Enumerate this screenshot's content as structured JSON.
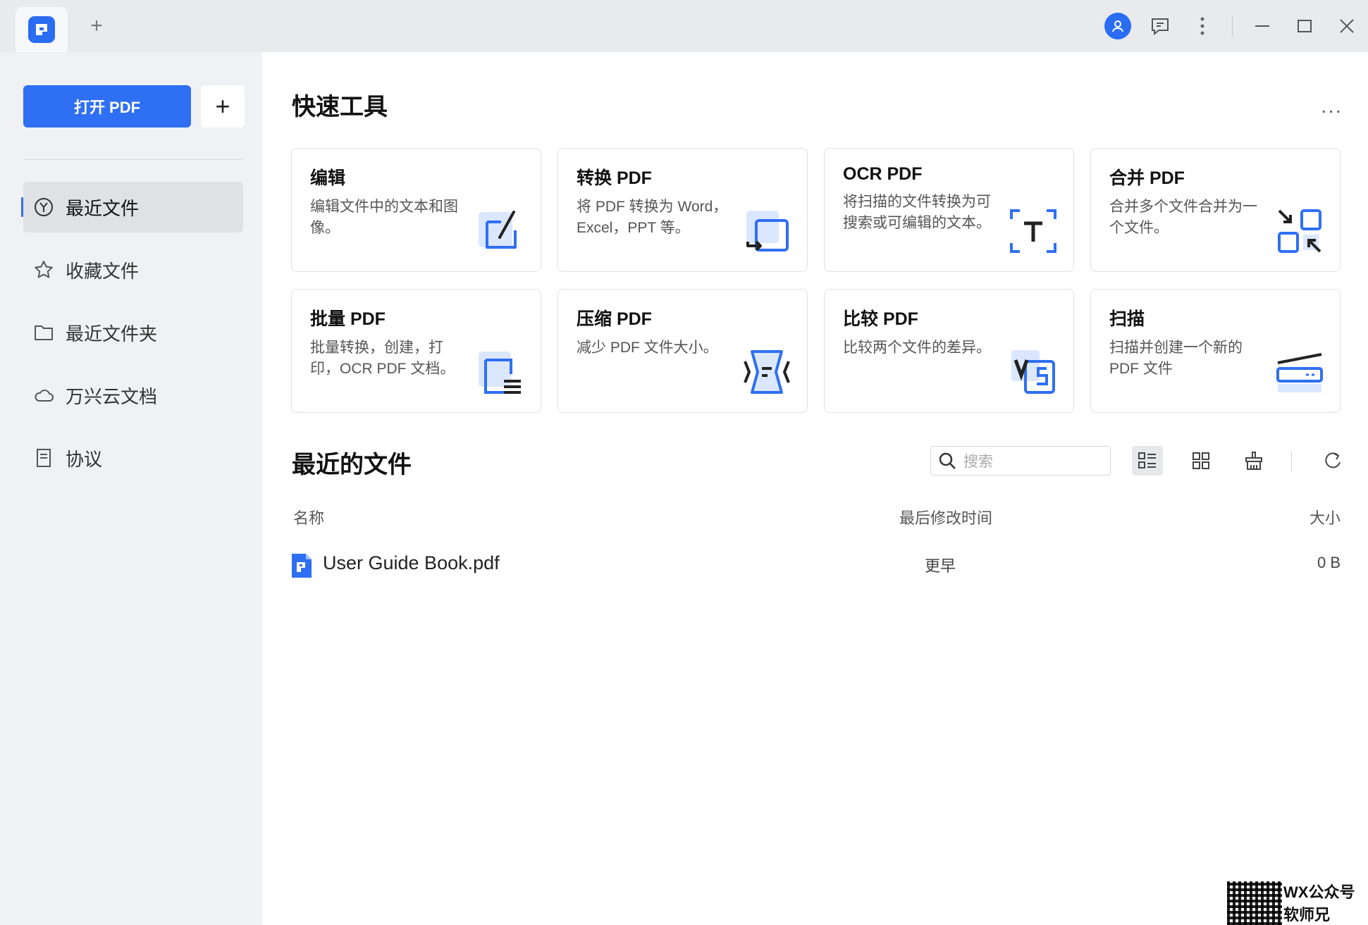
{
  "titlebar": {
    "new_tab_label": "+",
    "icons": [
      "app-logo-icon",
      "user-avatar-icon",
      "feedback-icon",
      "more-vertical-icon",
      "minimize-icon",
      "maximize-icon",
      "close-icon"
    ]
  },
  "sidebar": {
    "open_pdf_label": "打开 PDF",
    "add_label": "+",
    "items": [
      {
        "label": "最近文件",
        "icon": "recent-icon",
        "active": true
      },
      {
        "label": "收藏文件",
        "icon": "star-icon",
        "active": false
      },
      {
        "label": "最近文件夹",
        "icon": "folder-icon",
        "active": false
      },
      {
        "label": "万兴云文档",
        "icon": "cloud-icon",
        "active": false
      },
      {
        "label": "协议",
        "icon": "document-icon",
        "active": false
      }
    ]
  },
  "quick_tools": {
    "title": "快速工具",
    "more_label": "...",
    "cards": [
      {
        "title": "编辑",
        "desc": "编辑文件中的文本和图像。",
        "icon": "edit-icon"
      },
      {
        "title": "转换 PDF",
        "desc": "将 PDF 转换为 Word， Excel，PPT 等。",
        "icon": "convert-icon"
      },
      {
        "title": "OCR PDF",
        "desc": "将扫描的文件转换为可搜索或可编辑的文本。",
        "icon": "ocr-icon"
      },
      {
        "title": "合并 PDF",
        "desc": "合并多个文件合并为一个文件。",
        "icon": "merge-icon"
      },
      {
        "title": "批量 PDF",
        "desc": "批量转换，创建，打印，OCR PDF 文档。",
        "icon": "batch-icon"
      },
      {
        "title": "压缩 PDF",
        "desc": "减少 PDF 文件大小。",
        "icon": "compress-icon"
      },
      {
        "title": "比较 PDF",
        "desc": "比较两个文件的差异。",
        "icon": "compare-icon"
      },
      {
        "title": "扫描",
        "desc": "扫描并创建一个新的 PDF 文件",
        "icon": "scan-icon"
      }
    ]
  },
  "recent": {
    "title": "最近的文件",
    "search_placeholder": "搜索",
    "columns": {
      "name": "名称",
      "modified": "最后修改时间",
      "size": "大小"
    },
    "files": [
      {
        "name": "User Guide Book.pdf",
        "modified": "更早",
        "size": "0 B"
      }
    ]
  },
  "watermark": {
    "line1": "WX公众号",
    "line2": "软师兄"
  },
  "colors": {
    "accent": "#2f6ff3",
    "sidebar_bg": "#f0f1f4",
    "titlebar_bg": "#e9eaee"
  }
}
